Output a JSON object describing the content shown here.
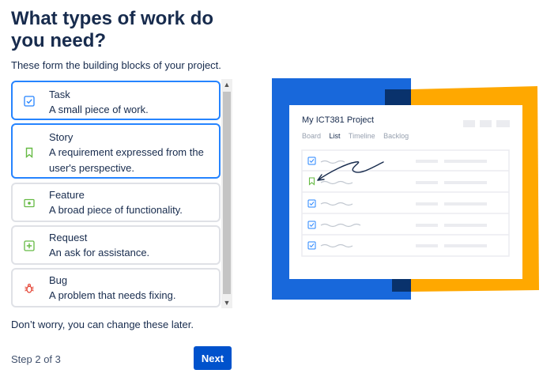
{
  "header": {
    "title": "What types of work do you need?",
    "subtitle": "These form the building blocks of your project."
  },
  "work_types": [
    {
      "name": "Task",
      "description": "A small piece of work.",
      "icon": "task-icon",
      "color": "#2684FF",
      "selected": true
    },
    {
      "name": "Story",
      "description": "A requirement expressed from the user's perspective.",
      "icon": "story-icon",
      "color": "#65BA43",
      "selected": true
    },
    {
      "name": "Feature",
      "description": "A broad piece of functionality.",
      "icon": "feature-icon",
      "color": "#65BA43",
      "selected": false
    },
    {
      "name": "Request",
      "description": "An ask for assistance.",
      "icon": "request-icon",
      "color": "#65BA43",
      "selected": false
    },
    {
      "name": "Bug",
      "description": "A problem that needs fixing.",
      "icon": "bug-icon",
      "color": "#E5493A",
      "selected": false
    }
  ],
  "footer": {
    "note": "Don’t worry, you can change these later.",
    "step": "Step 2 of 3",
    "next_label": "Next"
  },
  "illustration": {
    "project_title": "My ICT381 Project",
    "tabs": [
      "Board",
      "List",
      "Timeline",
      "Backlog"
    ],
    "active_tab": "List",
    "colors": {
      "blue": "#1868DB",
      "orange": "#FFA800",
      "navy": "#09326C"
    }
  }
}
